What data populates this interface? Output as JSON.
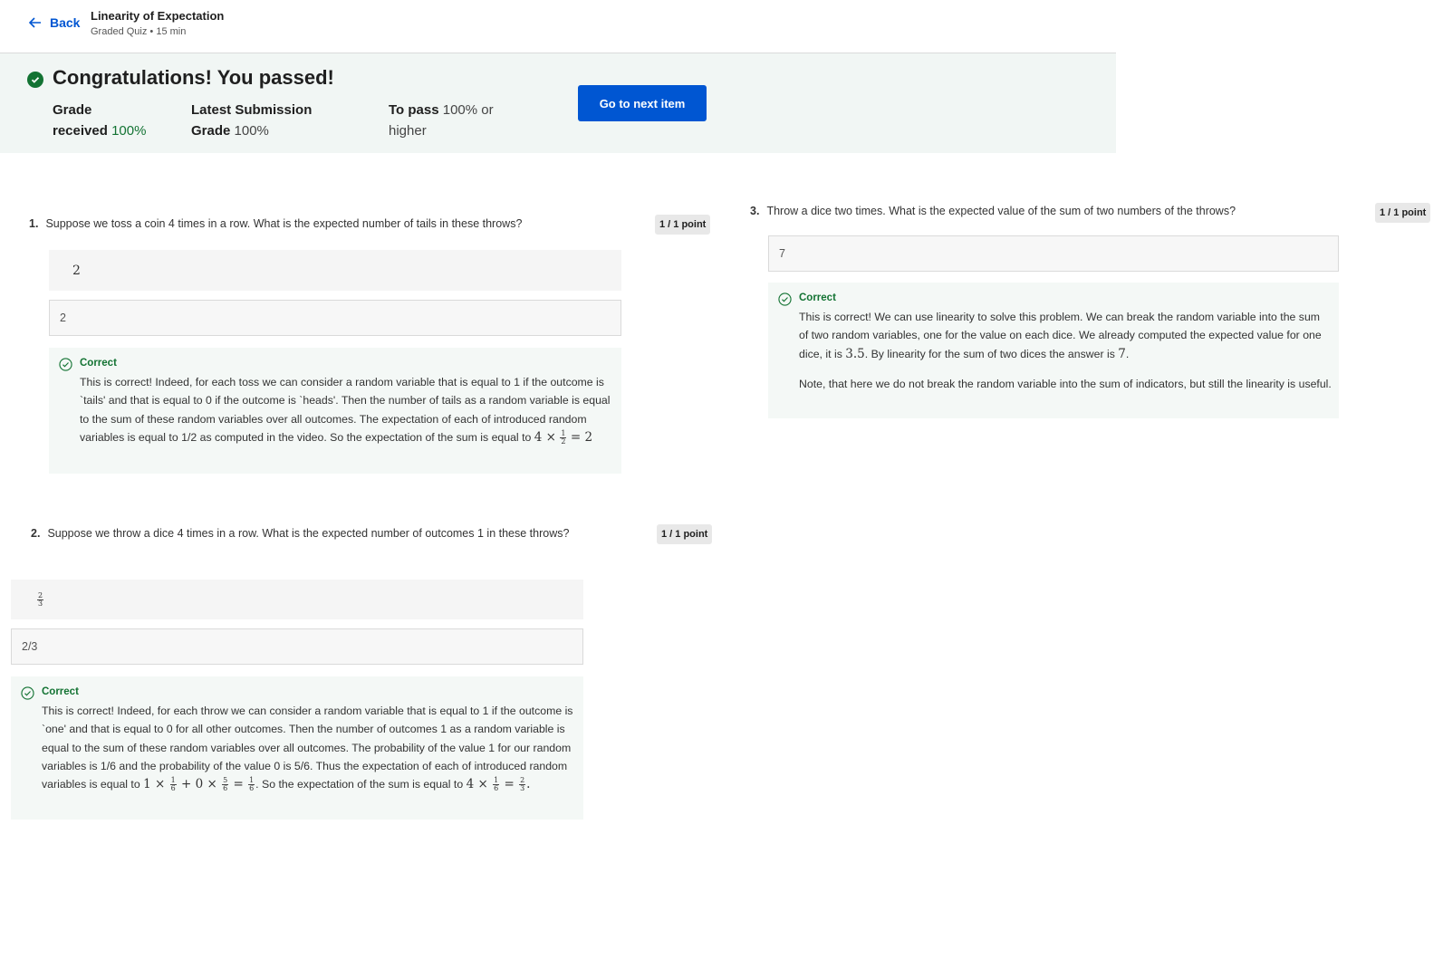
{
  "header": {
    "back_label": "Back",
    "title": "Linearity of Expectation",
    "subtitle": "Graded Quiz • 15 min"
  },
  "banner": {
    "headline": "Congratulations! You passed!",
    "grade_received_label_1": "Grade",
    "grade_received_label_2": "received",
    "grade_received_value": "100%",
    "latest_label_1": "Latest Submission",
    "latest_label_2": "Grade",
    "latest_value": "100%",
    "to_pass_label": "To pass",
    "to_pass_value_1": "100% or",
    "to_pass_value_2": "higher",
    "next_button": "Go to next item"
  },
  "questions": [
    {
      "number": "1.",
      "text": "Suppose we toss a coin 4 times in a row. What is the expected number of tails in these throws?",
      "points": "1 / 1 point",
      "rendered_answer": "2",
      "input_value": "2",
      "feedback_label": "Correct",
      "feedback_text": "This is correct! Indeed, for each toss we can consider a random variable that is equal to 1 if the outcome is `tails' and that is equal to 0 if the outcome is `heads'. Then the number of tails as a random variable is equal to the sum of these random variables over all outcomes. The expectation of each of introduced random variables is equal to 1/2 as computed in the video. So the expectation of the sum is equal to",
      "feedback_math_1": "4 ×",
      "feedback_math_frac_n": "1",
      "feedback_math_frac_d": "2",
      "feedback_math_2": "= 2"
    },
    {
      "number": "2.",
      "text": "Suppose we throw a dice 4 times in a row. What is the expected number of outcomes 1 in these throws?",
      "points": "1 / 1 point",
      "rendered_frac_n": "2",
      "rendered_frac_d": "3",
      "input_value": "2/3",
      "feedback_label": "Correct",
      "feedback_text_1": "This is correct! Indeed, for each throw we can consider a random variable that is equal to 1 if the outcome is `one' and that is equal to 0 for all other outcomes. Then the number of outcomes 1 as a random variable is equal to the sum of these random variables over all outcomes. The probability of the value 1 for our random variables is 1/6 and the probability of the value 0 is 5/6. Thus the expectation of each of introduced random variables is equal to",
      "feedback_text_2": ". So the expectation of the sum is equal to"
    },
    {
      "number": "3.",
      "text": "Throw a dice two times. What is the expected value of the sum of two numbers of the throws?",
      "points": "1 / 1 point",
      "input_value": "7",
      "feedback_label": "Correct",
      "feedback_text_1": "This is correct! We can use linearity to solve this problem. We can break the random variable into the sum of two random variables, one for the value on each dice. We already computed the expected value for one dice, it is",
      "feedback_math_1": "3.5",
      "feedback_text_2": ". By linearity for the sum of two dices the answer is",
      "feedback_math_2": "7",
      "feedback_text_3": ".",
      "feedback_note": "Note, that here we do not break the random variable into the sum of indicators, but still the linearity is useful."
    }
  ],
  "colors": {
    "primary": "#0056d2",
    "success": "#137333",
    "banner_bg": "#f1f6f4",
    "feedback_bg": "#f4f8f6"
  },
  "icons": [
    "back-arrow-icon",
    "check-circle-icon",
    "correct-check-icon"
  ]
}
